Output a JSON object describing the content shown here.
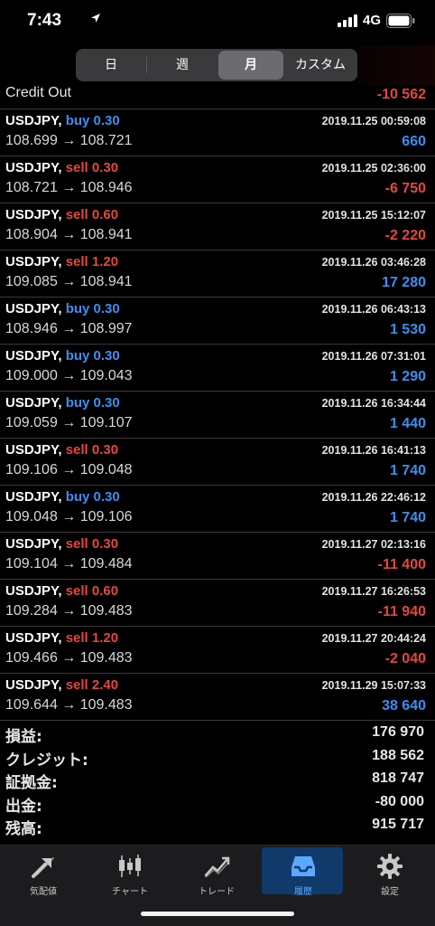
{
  "status_bar": {
    "time": "7:43",
    "network": "4G"
  },
  "segment": {
    "items": [
      "日",
      "週",
      "月",
      "カスタム"
    ],
    "selected": "月"
  },
  "credit_out": {
    "label": "Credit Out",
    "value": "-10 562"
  },
  "trades": [
    {
      "symbol": "USDJPY,",
      "side": "buy",
      "volume": "buy 0.30",
      "prices": "108.699 → 108.721",
      "date": "2019.11.25 00:59:08",
      "profit": "660"
    },
    {
      "symbol": "USDJPY,",
      "side": "sell",
      "volume": "sell 0.30",
      "prices": "108.721 → 108.946",
      "date": "2019.11.25 02:36:00",
      "profit": "-6 750"
    },
    {
      "symbol": "USDJPY,",
      "side": "sell",
      "volume": "sell 0.60",
      "prices": "108.904 → 108.941",
      "date": "2019.11.25 15:12:07",
      "profit": "-2 220"
    },
    {
      "symbol": "USDJPY,",
      "side": "sell",
      "volume": "sell 1.20",
      "prices": "109.085 → 108.941",
      "date": "2019.11.26 03:46:28",
      "profit": "17 280"
    },
    {
      "symbol": "USDJPY,",
      "side": "buy",
      "volume": "buy 0.30",
      "prices": "108.946 → 108.997",
      "date": "2019.11.26 06:43:13",
      "profit": "1 530"
    },
    {
      "symbol": "USDJPY,",
      "side": "buy",
      "volume": "buy 0.30",
      "prices": "109.000 → 109.043",
      "date": "2019.11.26 07:31:01",
      "profit": "1 290"
    },
    {
      "symbol": "USDJPY,",
      "side": "buy",
      "volume": "buy 0.30",
      "prices": "109.059 → 109.107",
      "date": "2019.11.26 16:34:44",
      "profit": "1 440"
    },
    {
      "symbol": "USDJPY,",
      "side": "sell",
      "volume": "sell 0.30",
      "prices": "109.106 → 109.048",
      "date": "2019.11.26 16:41:13",
      "profit": "1 740"
    },
    {
      "symbol": "USDJPY,",
      "side": "buy",
      "volume": "buy 0.30",
      "prices": "109.048 → 109.106",
      "date": "2019.11.26 22:46:12",
      "profit": "1 740"
    },
    {
      "symbol": "USDJPY,",
      "side": "sell",
      "volume": "sell 0.30",
      "prices": "109.104 → 109.484",
      "date": "2019.11.27 02:13:16",
      "profit": "-11 400"
    },
    {
      "symbol": "USDJPY,",
      "side": "sell",
      "volume": "sell 0.60",
      "prices": "109.284 → 109.483",
      "date": "2019.11.27 16:26:53",
      "profit": "-11 940"
    },
    {
      "symbol": "USDJPY,",
      "side": "sell",
      "volume": "sell 1.20",
      "prices": "109.466 → 109.483",
      "date": "2019.11.27 20:44:24",
      "profit": "-2 040"
    },
    {
      "symbol": "USDJPY,",
      "side": "sell",
      "volume": "sell 2.40",
      "prices": "109.644 → 109.483",
      "date": "2019.11.29 15:07:33",
      "profit": "38 640"
    }
  ],
  "summary": [
    {
      "label": "損益:",
      "value": "176 970"
    },
    {
      "label": "クレジット:",
      "value": "188 562"
    },
    {
      "label": "証拠金:",
      "value": "818 747"
    },
    {
      "label": "出金:",
      "value": "-80 000"
    },
    {
      "label": "残高:",
      "value": "915 717"
    }
  ],
  "tabs": [
    {
      "label": "気配値",
      "icon": "quotes-arrows-icon"
    },
    {
      "label": "チャート",
      "icon": "candlestick-icon"
    },
    {
      "label": "トレード",
      "icon": "trade-chart-icon"
    },
    {
      "label": "履歴",
      "icon": "inbox-tray-icon",
      "active": true
    },
    {
      "label": "設定",
      "icon": "gear-icon"
    }
  ],
  "colors": {
    "buy": "#3b8ff0",
    "sell": "#e5473e",
    "positive": "#3b8ff0",
    "negative": "#e5473e",
    "active_tab": "#5aa8ff"
  }
}
